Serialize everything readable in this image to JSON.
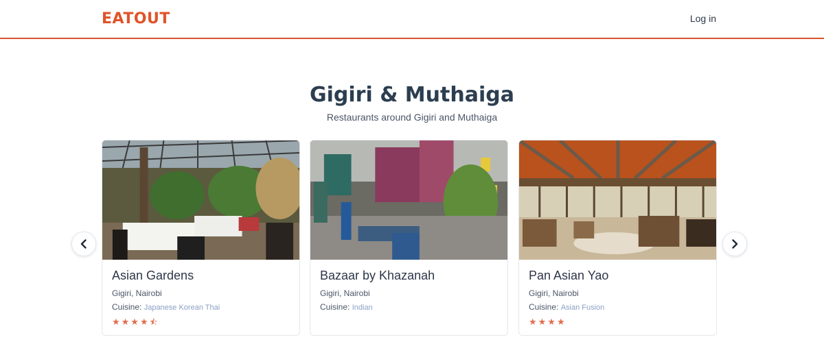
{
  "header": {
    "logo_text": "EATOUT",
    "login_label": "Log in"
  },
  "hero": {
    "title": "Gigiri & Muthaiga",
    "subtitle": "Restaurants around Gigiri and Muthaiga"
  },
  "carousel": {
    "prev_icon": "chevron-left-icon",
    "next_icon": "chevron-right-icon",
    "cuisine_label": "Cuisine:",
    "cards": [
      {
        "name": "Asian Gardens",
        "location": "Gigiri, Nairobi",
        "cuisine": "Japanese Korean Thai",
        "rating": 4.5,
        "stars": "★★★★⯪"
      },
      {
        "name": "Bazaar by Khazanah",
        "location": "Gigiri, Nairobi",
        "cuisine": "Indian",
        "rating": null,
        "stars": ""
      },
      {
        "name": "Pan Asian Yao",
        "location": "Gigiri, Nairobi",
        "cuisine": "Asian Fusion",
        "rating": 4,
        "stars": "★★★★"
      }
    ]
  },
  "colors": {
    "brand": "#e0542a",
    "header_border": "#d9532a",
    "star": "#e06d4f",
    "cuisine_value": "#8aa0c4"
  }
}
